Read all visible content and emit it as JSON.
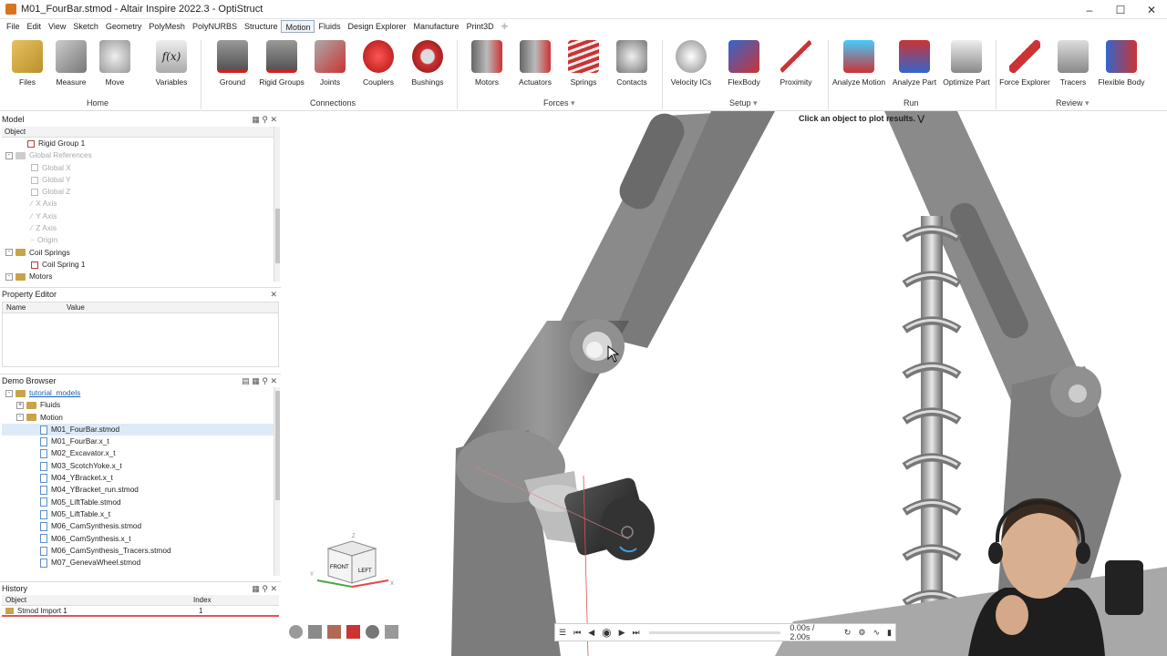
{
  "window": {
    "title": "M01_FourBar.stmod - Altair Inspire 2022.3 - OptiStruct"
  },
  "menu": [
    "File",
    "Edit",
    "View",
    "Sketch",
    "Geometry",
    "PolyMesh",
    "PolyNURBS",
    "Structure",
    "Motion",
    "Fluids",
    "Design Explorer",
    "Manufacture",
    "Print3D"
  ],
  "ribbon": {
    "buttons": [
      "Files",
      "Measure",
      "Move",
      "Variables",
      "Ground",
      "Rigid Groups",
      "Joints",
      "Couplers",
      "Bushings",
      "Motors",
      "Actuators",
      "Springs",
      "Contacts",
      "Velocity ICs",
      "FlexBody",
      "Proximity",
      "Analyze Motion",
      "Analyze Part",
      "Optimize Part",
      "Force Explorer",
      "Tracers",
      "Flexible Body"
    ],
    "groups": [
      "Home",
      "Connections",
      "Forces",
      "Setup",
      "Run",
      "Review"
    ]
  },
  "model_panel": {
    "title": "Model",
    "column": "Object",
    "rows": [
      "Rigid Group 1",
      "Global References",
      "Global X",
      "Global Y",
      "Global Z",
      "X Axis",
      "Y Axis",
      "Z Axis",
      "Origin",
      "Coil Springs",
      "Coil Spring 1",
      "Motors"
    ]
  },
  "property_editor": {
    "title": "Property Editor",
    "col_name": "Name",
    "col_value": "Value"
  },
  "demo_browser": {
    "title": "Demo Browser",
    "root": "tutorial_models",
    "folders": [
      "Fluids",
      "Motion"
    ],
    "files": [
      "M01_FourBar.stmod",
      "M01_FourBar.x_t",
      "M02_Excavator.x_t",
      "M03_ScotchYoke.x_t",
      "M04_YBracket.x_t",
      "M04_YBracket_run.stmod",
      "M05_LiftTable.stmod",
      "M05_LiftTable.x_t",
      "M06_CamSynthesis.stmod",
      "M06_CamSynthesis.x_t",
      "M06_CamSynthesis_Tracers.stmod",
      "M07_GenevaWheel.stmod"
    ]
  },
  "history": {
    "title": "History",
    "col_object": "Object",
    "col_index": "Index",
    "row_object": "Stmod Import 1",
    "row_index": "1"
  },
  "viewport": {
    "hint": "Click an object to plot results.",
    "viewcube": {
      "front": "FRONT",
      "left": "LEFT",
      "z": "Z",
      "x": "X",
      "y": "Y"
    },
    "time": "0.00s / 2.00s"
  }
}
